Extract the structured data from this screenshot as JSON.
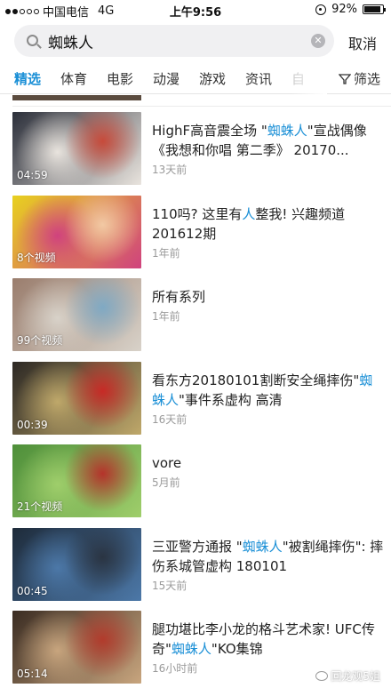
{
  "status_bar": {
    "carrier": "中国电信",
    "network": "4G",
    "time": "上午9:56",
    "battery": "92%",
    "battery_level": 0.92
  },
  "search": {
    "query": "蜘蛛人",
    "cancel_label": "取消"
  },
  "tabs": {
    "items": [
      "精选",
      "体育",
      "电影",
      "动漫",
      "游戏",
      "资讯",
      "自"
    ],
    "active": "精选",
    "filter_label": "筛选"
  },
  "results": [
    {
      "title_parts": [
        "HighF高音震全场 \"",
        "蜘蛛人",
        "\"宣战偶像《我想和你唱 第二季》 20170..."
      ],
      "time": "13天前",
      "badge": "04:59",
      "thumb_colors": [
        "#2b2f3a",
        "#e9e4de",
        "#c74a3a"
      ]
    },
    {
      "title_parts": [
        "110吗? 这里有",
        "人",
        "整我! 兴趣频道201612期"
      ],
      "time": "1年前",
      "badge": "8个视频",
      "thumb_colors": [
        "#e8d11f",
        "#d0427e",
        "#f2c9a4"
      ]
    },
    {
      "title_parts": [
        "所有系列",
        "",
        ""
      ],
      "time": "1年前",
      "badge": "99个视频",
      "thumb_colors": [
        "#9a7d6d",
        "#d8d2c9",
        "#7fa9c4"
      ]
    },
    {
      "title_parts": [
        "看东方20180101割断安全绳摔伤\"",
        "蜘蛛人",
        "\"事件系虚构 高清"
      ],
      "time": "16天前",
      "badge": "00:39",
      "thumb_colors": [
        "#2c2824",
        "#bfa86a",
        "#c72a26"
      ]
    },
    {
      "title_parts": [
        "vore",
        "",
        ""
      ],
      "time": "5月前",
      "badge": "21个视频",
      "thumb_colors": [
        "#4e8f3a",
        "#9fce6b",
        "#b5332b"
      ]
    },
    {
      "title_parts": [
        "三亚警方通报 \"",
        "蜘蛛人",
        "\"被割绳摔伤\": 摔伤系城管虚构 180101"
      ],
      "time": "15天前",
      "badge": "00:45",
      "thumb_colors": [
        "#1e2b3a",
        "#4c78a8",
        "#2a3442"
      ]
    },
    {
      "title_parts": [
        "腿功堪比李小龙的格斗艺术家! UFC传奇\"",
        "蜘蛛人",
        "\"KO集锦"
      ],
      "time": "16小时前",
      "badge": "05:14",
      "thumb_colors": [
        "#3a2c22",
        "#c8a57e",
        "#b23b2c"
      ]
    }
  ],
  "watermark": {
    "text": "回龙观5姐"
  }
}
